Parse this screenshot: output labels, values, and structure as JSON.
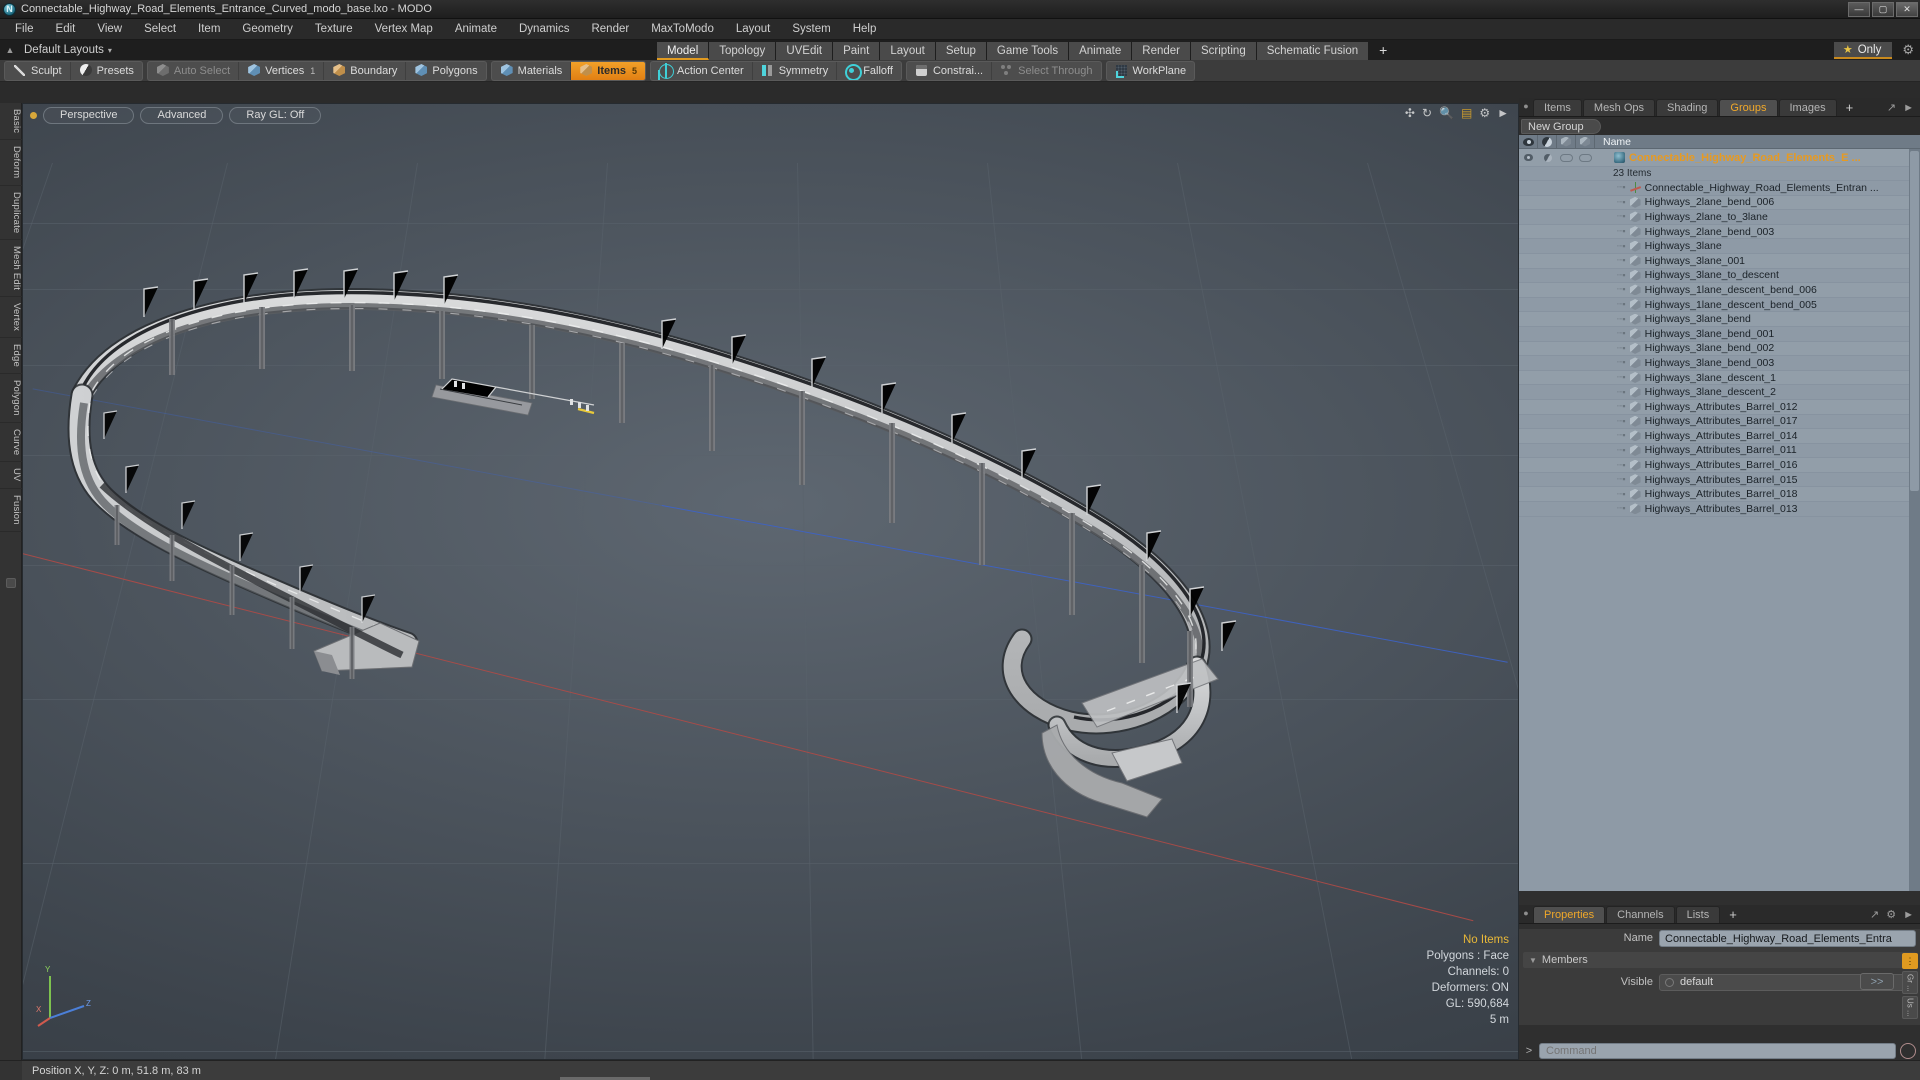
{
  "window": {
    "title": "Connectable_Highway_Road_Elements_Entrance_Curved_modo_base.lxo - MODO",
    "app_icon": "modo-logo-icon",
    "minimize": "—",
    "maximize": "▢",
    "close": "✕"
  },
  "menubar": {
    "items": [
      "File",
      "Edit",
      "View",
      "Select",
      "Item",
      "Geometry",
      "Texture",
      "Vertex Map",
      "Animate",
      "Dynamics",
      "Render",
      "MaxToModo",
      "Layout",
      "System",
      "Help"
    ]
  },
  "layoutbar": {
    "up_icon": "collapse-up-icon",
    "label": "Default Layouts",
    "caret": "▾",
    "tabs": [
      {
        "label": "Model",
        "active": true
      },
      {
        "label": "Topology",
        "active": false
      },
      {
        "label": "UVEdit",
        "active": false
      },
      {
        "label": "Paint",
        "active": false
      },
      {
        "label": "Layout",
        "active": false
      },
      {
        "label": "Setup",
        "active": false
      },
      {
        "label": "Game Tools",
        "active": false
      },
      {
        "label": "Animate",
        "active": false
      },
      {
        "label": "Render",
        "active": false
      },
      {
        "label": "Scripting",
        "active": false
      },
      {
        "label": "Schematic Fusion",
        "active": false
      }
    ],
    "plus": "+",
    "only_star": "★",
    "only_label": "Only",
    "gear_icon": "gear-icon"
  },
  "toolbar": {
    "group1": [
      {
        "label": "Sculpt",
        "icon": "pencil-icon",
        "state": "normal"
      },
      {
        "label": "Presets",
        "icon": "sphere-icon",
        "state": "normal"
      }
    ],
    "group2": [
      {
        "label": "Auto Select",
        "icon": "cube-grey-icon",
        "state": "dim",
        "count": ""
      },
      {
        "label": "Vertices",
        "icon": "cube-blue-icon",
        "state": "normal",
        "count": "1"
      },
      {
        "label": "Boundary",
        "icon": "cube-orange-icon",
        "state": "normal",
        "count": ""
      },
      {
        "label": "Polygons",
        "icon": "cube-blue-icon",
        "state": "normal",
        "count": ""
      }
    ],
    "group3": [
      {
        "label": "Materials",
        "icon": "cube-blue-icon",
        "state": "normal",
        "count": ""
      },
      {
        "label": "Items",
        "icon": "cube-orange-icon",
        "state": "selected",
        "count": "5"
      }
    ],
    "group4": [
      {
        "label": "Action Center",
        "icon": "action-center-icon",
        "state": "normal"
      },
      {
        "label": "Symmetry",
        "icon": "symmetry-icon",
        "state": "normal"
      },
      {
        "label": "Falloff",
        "icon": "falloff-icon",
        "state": "normal"
      }
    ],
    "group5": [
      {
        "label": "Constrai...",
        "icon": "constrain-icon",
        "state": "normal"
      },
      {
        "label": "Select Through",
        "icon": "select-through-icon",
        "state": "dim"
      }
    ],
    "group6": [
      {
        "label": "WorkPlane",
        "icon": "workplane-icon",
        "state": "normal"
      }
    ]
  },
  "left_tool_tabs": [
    "Basic",
    "Deform",
    "Duplicate",
    "Mesh Edit",
    "Vertex",
    "Edge",
    "Polygon",
    "Curve",
    "UV",
    "Fusion"
  ],
  "viewport": {
    "dot": "active-indicator",
    "pills": [
      "Perspective",
      "Advanced",
      "Ray GL: Off"
    ],
    "header_icons": [
      "move-icon",
      "rotate-icon",
      "zoom-icon",
      "light-icon",
      "gear-icon",
      "expand-icon"
    ],
    "info": {
      "selection": "No Items",
      "polygons": "Polygons : Face",
      "channels": "Channels: 0",
      "deformers": "Deformers: ON",
      "gl": "GL: 590,684",
      "scale": "5 m"
    },
    "gizmo_axes": [
      "Y",
      "X",
      "Z"
    ]
  },
  "right_panel": {
    "tabs": [
      {
        "label": "Items",
        "active": false
      },
      {
        "label": "Mesh Ops",
        "active": false
      },
      {
        "label": "Shading",
        "active": false
      },
      {
        "label": "Groups",
        "active": true
      },
      {
        "label": "Images",
        "active": false
      }
    ],
    "plus": "+",
    "new_group_button": "New Group",
    "tree_header": {
      "col_icons": [
        "eye-icon",
        "shading-icon",
        "cube-icon",
        "cube-wire-icon"
      ],
      "name": "Name"
    },
    "group": {
      "name": "Connectable_Highway_Road_Elements_E  ...",
      "item_count": "23 Items"
    },
    "items": [
      {
        "label": "Connectable_Highway_Road_Elements_Entran ...",
        "icon": "locator-icon"
      },
      {
        "label": "Highways_2lane_bend_006",
        "icon": "mesh-icon"
      },
      {
        "label": "Highways_2lane_to_3lane",
        "icon": "mesh-icon"
      },
      {
        "label": "Highways_2lane_bend_003",
        "icon": "mesh-icon"
      },
      {
        "label": "Highways_3lane",
        "icon": "mesh-icon"
      },
      {
        "label": "Highways_3lane_001",
        "icon": "mesh-icon"
      },
      {
        "label": "Highways_3lane_to_descent",
        "icon": "mesh-icon"
      },
      {
        "label": "Highways_1lane_descent_bend_006",
        "icon": "mesh-icon"
      },
      {
        "label": "Highways_1lane_descent_bend_005",
        "icon": "mesh-icon"
      },
      {
        "label": "Highways_3lane_bend",
        "icon": "mesh-icon"
      },
      {
        "label": "Highways_3lane_bend_001",
        "icon": "mesh-icon"
      },
      {
        "label": "Highways_3lane_bend_002",
        "icon": "mesh-icon"
      },
      {
        "label": "Highways_3lane_bend_003",
        "icon": "mesh-icon"
      },
      {
        "label": "Highways_3lane_descent_1",
        "icon": "mesh-icon"
      },
      {
        "label": "Highways_3lane_descent_2",
        "icon": "mesh-icon"
      },
      {
        "label": "Highways_Attributes_Barrel_012",
        "icon": "mesh-icon"
      },
      {
        "label": "Highways_Attributes_Barrel_017",
        "icon": "mesh-icon"
      },
      {
        "label": "Highways_Attributes_Barrel_014",
        "icon": "mesh-icon"
      },
      {
        "label": "Highways_Attributes_Barrel_011",
        "icon": "mesh-icon"
      },
      {
        "label": "Highways_Attributes_Barrel_016",
        "icon": "mesh-icon"
      },
      {
        "label": "Highways_Attributes_Barrel_015",
        "icon": "mesh-icon"
      },
      {
        "label": "Highways_Attributes_Barrel_018",
        "icon": "mesh-icon"
      },
      {
        "label": "Highways_Attributes_Barrel_013",
        "icon": "mesh-icon"
      }
    ]
  },
  "properties": {
    "tabs": [
      {
        "label": "Properties",
        "active": true
      },
      {
        "label": "Channels",
        "active": false
      },
      {
        "label": "Lists",
        "active": false
      }
    ],
    "plus": "+",
    "name_label": "Name",
    "name_value": "Connectable_Highway_Road_Elements_Entra",
    "members_section": "Members",
    "visible_label": "Visible",
    "visible_value": "default",
    "forward_button": ">>",
    "sidebar_tabs": [
      "Gr ...",
      "Us ..."
    ]
  },
  "command_line": {
    "prompt": ">",
    "placeholder": "Command",
    "record_icon": "record-icon"
  },
  "statusbar": {
    "position_text": "Position X, Y, Z:   0 m, 51.8 m, 83 m"
  },
  "colors": {
    "accent_orange": "#e09a20",
    "tree_bg": "#8e9aa6",
    "viewport_bg": "#4b535c",
    "axis_x": "#b04a46",
    "axis_z": "#3d63c8",
    "highlight_yellow": "#e8b838"
  }
}
